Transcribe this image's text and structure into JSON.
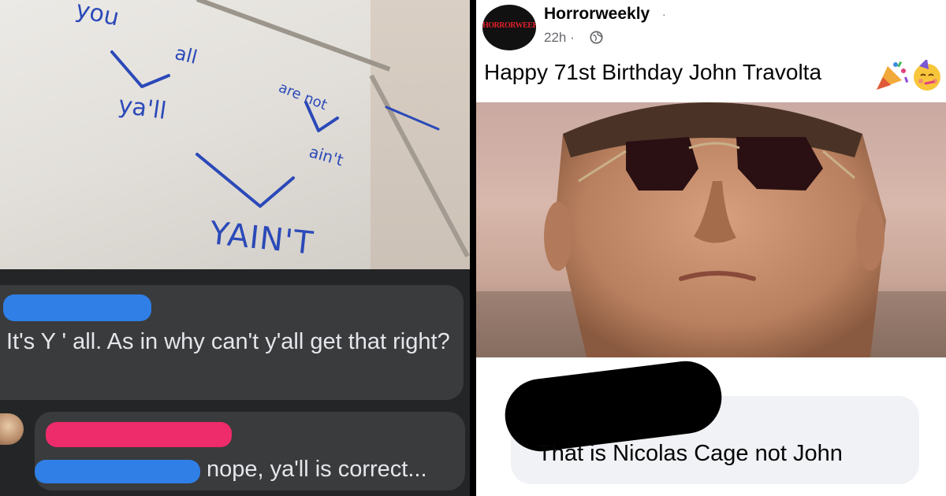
{
  "left_panel": {
    "whiteboard_words": {
      "you": "you",
      "all": "all",
      "yall": "ya'll",
      "are_not": "are not",
      "aint": "ain't",
      "yaint": "YAIN'T"
    },
    "comment_1": {
      "author_redacted": true,
      "text": "It's Y ' all.  As in why can't y'all get that right?"
    },
    "comment_2": {
      "author_redacted": true,
      "text": "nope, ya'll is correct..."
    },
    "colors": {
      "background": "#242526",
      "bubble": "#3a3b3c",
      "text": "#e4e6eb",
      "redact_blue": "#2f7fe6",
      "redact_pink": "#ee2b6b",
      "marker_blue": "#2b49b8"
    }
  },
  "right_panel": {
    "page_name": "Horrorweekly",
    "logo_text": "HORRORWEEKLY",
    "timestamp": "22h",
    "visibility_icon": "globe-icon",
    "post_text": "Happy 71st Birthday John Travolta",
    "post_emojis": [
      "party-popper-icon",
      "partying-face-icon"
    ],
    "comment": {
      "author_redacted": true,
      "text": "That is Nicolas Cage not John"
    },
    "colors": {
      "background": "#ffffff",
      "bubble": "#f0f2f5",
      "text": "#050505",
      "meta": "#65676b",
      "highlight_yellow": "#f1ec2a"
    }
  }
}
